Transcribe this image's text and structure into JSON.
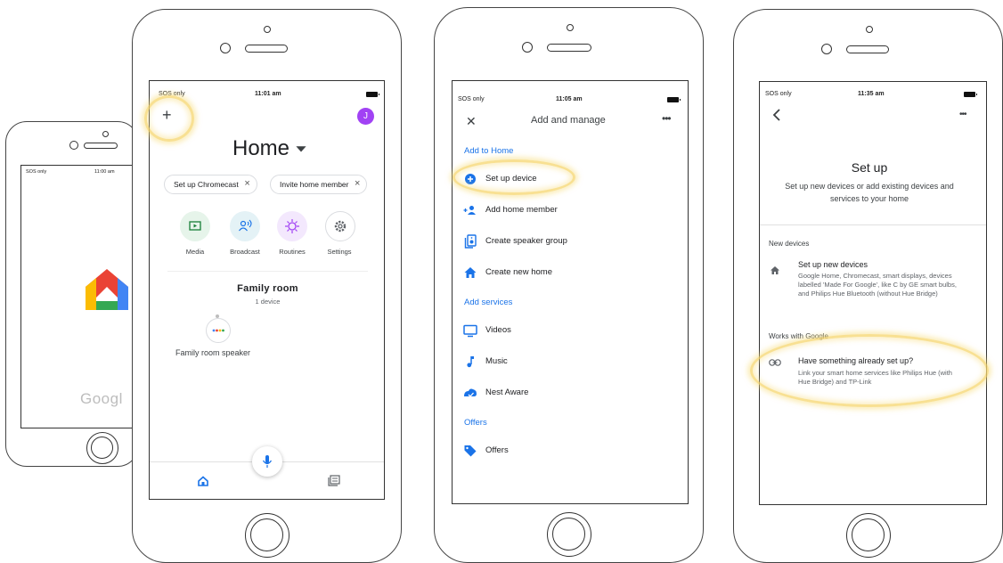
{
  "phone1": {
    "status_left": "SOS only",
    "status_time": "11:00 am",
    "brand_text": "Googl"
  },
  "phone2": {
    "status_left": "SOS only",
    "status_time": "11:01 am",
    "avatar_letter": "J",
    "title": "Home",
    "chips": [
      "Set up Chromecast",
      "Invite home member"
    ],
    "actions": [
      {
        "label": "Media",
        "icon": "media-icon",
        "bg": "#e6f4ea",
        "fg": "#188038"
      },
      {
        "label": "Broadcast",
        "icon": "broadcast-icon",
        "bg": "#e4f2f6",
        "fg": "#1a73e8"
      },
      {
        "label": "Routines",
        "icon": "routines-icon",
        "bg": "#f3e8fd",
        "fg": "#a142f4"
      },
      {
        "label": "Settings",
        "icon": "settings-icon",
        "bg": "#ffffff",
        "fg": "#5f6368"
      }
    ],
    "room_name": "Family room",
    "room_count": "1 device",
    "device_label": "Family room speaker"
  },
  "phone3": {
    "status_left": "SOS only",
    "status_time": "11:05 am",
    "title": "Add and manage",
    "sections": [
      {
        "title": "Add to Home",
        "items": [
          {
            "label": "Set up device",
            "icon": "add-circle-icon"
          },
          {
            "label": "Add home member",
            "icon": "person-add-icon"
          },
          {
            "label": "Create speaker group",
            "icon": "speaker-group-icon"
          },
          {
            "label": "Create new home",
            "icon": "home-icon"
          }
        ]
      },
      {
        "title": "Add services",
        "items": [
          {
            "label": "Videos",
            "icon": "tv-icon"
          },
          {
            "label": "Music",
            "icon": "music-note-icon"
          },
          {
            "label": "Nest Aware",
            "icon": "nest-aware-icon"
          }
        ]
      },
      {
        "title": "Offers",
        "items": [
          {
            "label": "Offers",
            "icon": "tag-icon"
          }
        ]
      }
    ]
  },
  "phone4": {
    "status_left": "SOS only",
    "status_time": "11:35 am",
    "title": "Set up",
    "subtitle": "Set up new devices or add existing devices and services to your home",
    "new_devices_header": "New devices",
    "new_devices_title": "Set up new devices",
    "new_devices_desc": "Google Home, Chromecast, smart displays, devices labelled 'Made For Google', like C by GE smart bulbs, and Philips Hue Bluetooth (without Hue Bridge)",
    "works_with_header": "Works with Google",
    "existing_title": "Have something already set up?",
    "existing_desc": "Link your smart home services like Philips Hue (with Hue Bridge) and TP-Link"
  },
  "colors": {
    "accent": "#1a73e8",
    "highlight": "#f6d66e",
    "avatar": "#a142f4"
  }
}
